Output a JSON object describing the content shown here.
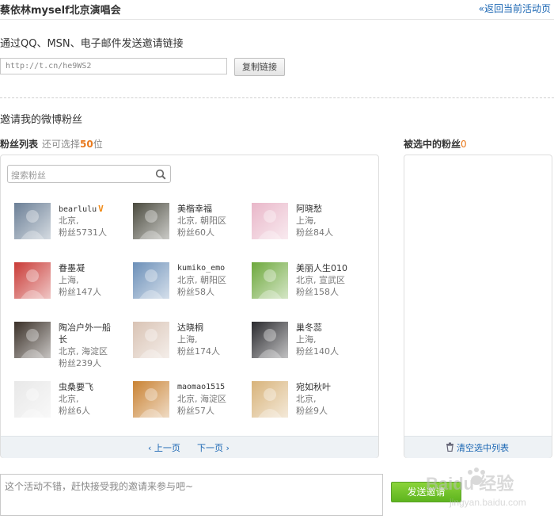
{
  "header": {
    "title": "蔡依林myself北京演唱会",
    "back_link": "«返回当前活动页"
  },
  "invite": {
    "heading": "通过QQ、MSN、电子邮件发送邀请链接",
    "url": "http://t.cn/he9WS2",
    "copy_label": "复制链接"
  },
  "fans_section": {
    "heading": "邀请我的微博粉丝",
    "list_title": "粉丝列表",
    "remain_prefix": "还可选择",
    "remain_count": "50",
    "remain_suffix": "位",
    "search_placeholder": "搜索粉丝",
    "prev_label": "上一页",
    "next_label": "下一页"
  },
  "selected": {
    "title": "被选中的粉丝",
    "count": "0",
    "clear_label": "清空选中列表"
  },
  "fans": [
    {
      "name": "bearlulu",
      "verified": true,
      "line1": "北京,",
      "line2": "粉丝5731人",
      "avatar_color": "#6b7f96"
    },
    {
      "name": "美楷幸福",
      "line1": "北京, 朝阳区",
      "line2": "粉丝60人",
      "avatar_color": "#4a4a3e"
    },
    {
      "name": "阿晓愁",
      "line1": "上海,",
      "line2": "粉丝84人",
      "avatar_color": "#e9b7c9"
    },
    {
      "name": "眷墨凝",
      "line1": "上海,",
      "line2": "粉丝147人",
      "avatar_color": "#c93a36"
    },
    {
      "name": "kumiko_emo",
      "line1": "北京, 朝阳区",
      "line2": "粉丝58人",
      "avatar_color": "#6b8fb8"
    },
    {
      "name": "美丽人生010",
      "line1": "北京, 宣武区",
      "line2": "粉丝158人",
      "avatar_color": "#6da83c"
    },
    {
      "name": "陶冶户外一船",
      "name2": "长",
      "line1": "北京, 海淀区",
      "line2": "粉丝239人",
      "avatar_color": "#3a3028"
    },
    {
      "name": "达晓桐",
      "line1": "上海,",
      "line2": "粉丝174人",
      "avatar_color": "#d9c3b4"
    },
    {
      "name": "巢冬蕊",
      "line1": "上海,",
      "line2": "粉丝140人",
      "avatar_color": "#2a2a2e"
    },
    {
      "name": "虫桑要飞",
      "line1": "北京,",
      "line2": "粉丝6人",
      "avatar_color": "#e8e8e8"
    },
    {
      "name": "maomao1515",
      "line1": "北京, 海淀区",
      "line2": "粉丝57人",
      "avatar_color": "#c98233"
    },
    {
      "name": "宛如秋叶",
      "line1": "北京,",
      "line2": "粉丝9人",
      "avatar_color": "#d8b37a"
    }
  ],
  "message": {
    "text": "这个活动不错，赶快接受我的邀请来参与吧~",
    "send_label": "发送邀请"
  },
  "watermark": {
    "text": "Baidu 经验",
    "url": "jingyan.baidu.com"
  }
}
